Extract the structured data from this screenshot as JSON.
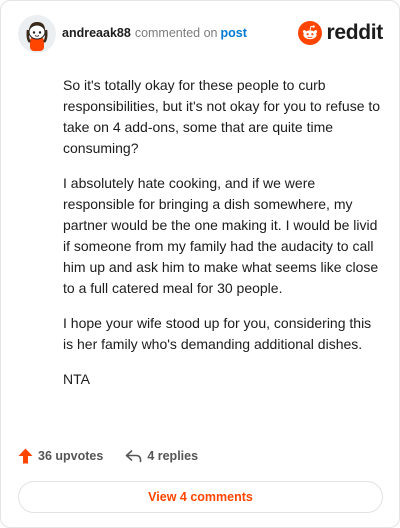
{
  "comment": {
    "author": "andreaak88",
    "verb": "commented on",
    "target": "post",
    "brand": "reddit",
    "paragraphs": [
      "So it's totally okay for these people to curb responsibilities, but it's not okay for you to refuse to take on 4 add-ons, some that are quite time consuming?",
      "I absolutely hate cooking, and if we were responsible for bringing a dish somewhere, my partner would be the one making it. I would be livid if someone from my family had the audacity to call him up and ask him to make what seems like close to a full catered meal for 30 people.",
      "I hope your wife stood up for you, considering this is her family who's demanding additional dishes.",
      "NTA"
    ],
    "upvotes": "36 upvotes",
    "replies": "4 replies",
    "view_label": "View 4 comments"
  },
  "colors": {
    "accent": "#ff4500",
    "link": "#0079d3",
    "text": "#1c1c1c"
  },
  "icons": {
    "avatar": "snoo-avatar",
    "brand": "reddit-logo-icon",
    "upvote": "upvote-arrow-icon",
    "reply": "reply-arrow-icon"
  }
}
